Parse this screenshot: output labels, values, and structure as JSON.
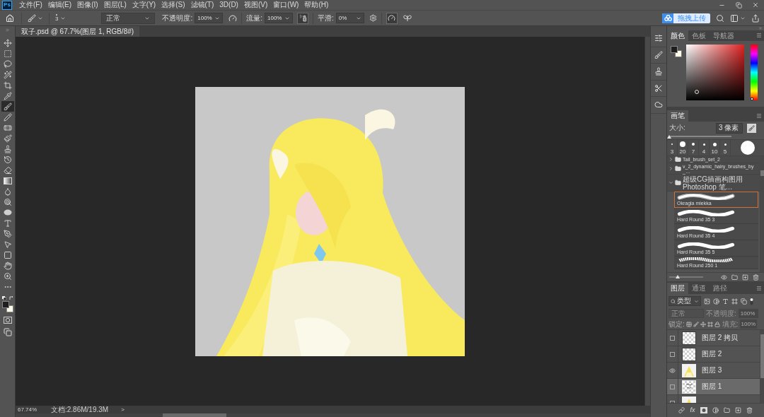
{
  "menu_bar": {
    "logo": "Ps",
    "items": [
      "文件(F)",
      "编辑(E)",
      "图像(I)",
      "图层(L)",
      "文字(Y)",
      "选择(S)",
      "滤镜(T)",
      "3D(D)",
      "视图(V)",
      "窗口(W)",
      "帮助(H)"
    ]
  },
  "options_bar": {
    "brush_size": "3",
    "mode": "正常",
    "opacity_label": "不透明度:",
    "opacity": "100%",
    "flow_label": "流量:",
    "flow": "100%",
    "smoothing_label": "平滑:",
    "smoothing": "0%",
    "airbrush_on": true,
    "pressure_size_on": true,
    "upload_button": "拖拽上传"
  },
  "document_tab": {
    "title": "双子.psd @ 67.7%(图层 1, RGB/8#)"
  },
  "tools": [
    {
      "kind": "move",
      "selected": false
    },
    {
      "kind": "marquee",
      "selected": false
    },
    {
      "kind": "lasso",
      "selected": false
    },
    {
      "kind": "quick_select",
      "selected": false
    },
    {
      "kind": "crop",
      "selected": false
    },
    {
      "kind": "eyedropper",
      "selected": false
    },
    {
      "kind": "brush",
      "selected": true
    },
    {
      "kind": "pencil",
      "selected": false
    },
    {
      "kind": "healing",
      "selected": false
    },
    {
      "kind": "mixer",
      "selected": false
    },
    {
      "kind": "stamp",
      "selected": false
    },
    {
      "kind": "history",
      "selected": false
    },
    {
      "kind": "eraser",
      "selected": false
    },
    {
      "kind": "gradient",
      "selected": false
    },
    {
      "kind": "blur",
      "selected": false
    },
    {
      "kind": "dodge",
      "selected": false
    },
    {
      "kind": "sponge",
      "selected": false
    },
    {
      "kind": "type",
      "selected": false
    },
    {
      "kind": "pen",
      "selected": false
    },
    {
      "kind": "path_select",
      "selected": false
    },
    {
      "kind": "shape",
      "selected": false
    },
    {
      "kind": "hand",
      "selected": false
    },
    {
      "kind": "zoom",
      "selected": false
    },
    {
      "kind": "more",
      "selected": false
    }
  ],
  "status_bar": {
    "zoom": "67.74%",
    "doc_size": "文档:2.86M/19.3M",
    "arrow": ">"
  },
  "color_panel": {
    "tabs": [
      {
        "label": "颜色",
        "selected": true
      },
      {
        "label": "色板",
        "selected": false
      },
      {
        "label": "导航器",
        "selected": false
      }
    ],
    "hue_slider": {
      "level": 0.0
    }
  },
  "brush_panel": {
    "title": "画笔",
    "size_label": "大小:",
    "size": "3 像素",
    "size_slider": {
      "level": 0.0
    },
    "presets": [
      "3",
      "20",
      "7",
      "4",
      "10",
      "5"
    ],
    "tree": [
      {
        "kind": "folder",
        "name": "Tail_brush_set_2",
        "expanded": false
      },
      {
        "kind": "folder",
        "name": "v_2_dynamic_hairy_brushes_by_…",
        "expanded": false
      },
      {
        "kind": "folder",
        "name": "超级CG插画构图用 Photoshop 笔…",
        "expanded": true,
        "children": [
          {
            "name": "Okragla miekka",
            "kind": "soft",
            "selected": true
          },
          {
            "name": "Hard Round 35 3",
            "kind": "hard",
            "selected": false
          },
          {
            "name": "Hard Round 35 4",
            "kind": "hard",
            "selected": false
          },
          {
            "name": "Hard Round 35 5",
            "kind": "hard",
            "selected": false
          },
          {
            "name": "Hard Round 250 1",
            "kind": "textured",
            "selected": false
          }
        ]
      }
    ],
    "preview_slider": {
      "level": 0.25
    }
  },
  "layers_panel": {
    "tabs": [
      {
        "label": "图层",
        "selected": true
      },
      {
        "label": "通道",
        "selected": false
      },
      {
        "label": "路径",
        "selected": false
      }
    ],
    "filter": "类型",
    "blend_mode": {
      "value": "正常",
      "disabled": true
    },
    "opacity_label": "不透明度:",
    "opacity": {
      "value": "100%",
      "disabled": true
    },
    "lock_label": "锁定:",
    "fill_label": "填充:",
    "fill": {
      "value": "100%",
      "disabled": true
    },
    "layers": [
      {
        "name": "图层 2 拷贝",
        "visible": false,
        "selected": false,
        "kind": "transparent"
      },
      {
        "name": "图层 2",
        "visible": false,
        "selected": false,
        "kind": "transparent"
      },
      {
        "name": "图层 3",
        "visible": true,
        "selected": false,
        "kind": "art"
      },
      {
        "name": "图层 1",
        "visible": false,
        "selected": true,
        "kind": "sketch"
      },
      {
        "visible": false,
        "selected": false,
        "kind": "art"
      }
    ],
    "fx_button": "fx"
  }
}
